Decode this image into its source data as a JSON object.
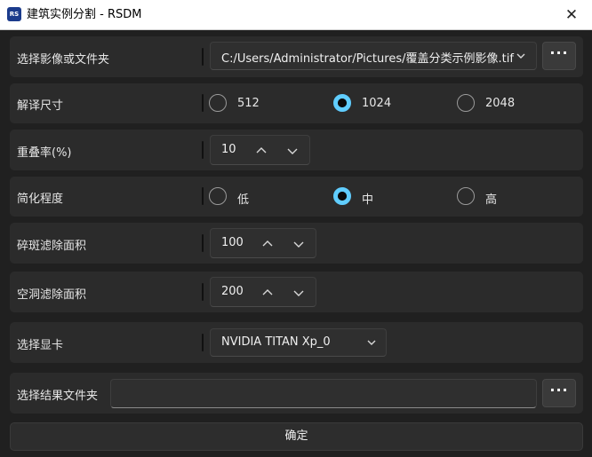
{
  "window": {
    "app_icon_text": "RS",
    "title": "建筑实例分割 - RSDM",
    "close_glyph": "✕"
  },
  "rows": {
    "image_select": {
      "label": "选择影像或文件夹",
      "value": "C:/Users/Administrator/Pictures/覆盖分类示例影像.tif",
      "browse_label": "···"
    },
    "tile_size": {
      "label": "解译尺寸",
      "options": [
        "512",
        "1024",
        "2048"
      ],
      "selected": "1024"
    },
    "overlap": {
      "label": "重叠率(%)",
      "value": "10"
    },
    "simplify": {
      "label": "简化程度",
      "options": [
        "低",
        "中",
        "高"
      ],
      "selected": "中"
    },
    "patch_filter": {
      "label": "碎斑滤除面积",
      "value": "100"
    },
    "hole_filter": {
      "label": "空洞滤除面积",
      "value": "200"
    },
    "gpu": {
      "label": "选择显卡",
      "value": "NVIDIA TITAN Xp_0"
    },
    "output": {
      "label": "选择结果文件夹",
      "value": "",
      "browse_label": "···"
    }
  },
  "confirm_label": "确定",
  "colors": {
    "background": "#202020",
    "row": "#2b2b2b",
    "accent": "#60cdff"
  },
  "icons": [
    "close-icon",
    "chevron-down-icon",
    "chevron-up-icon",
    "more-dots-icon"
  ]
}
